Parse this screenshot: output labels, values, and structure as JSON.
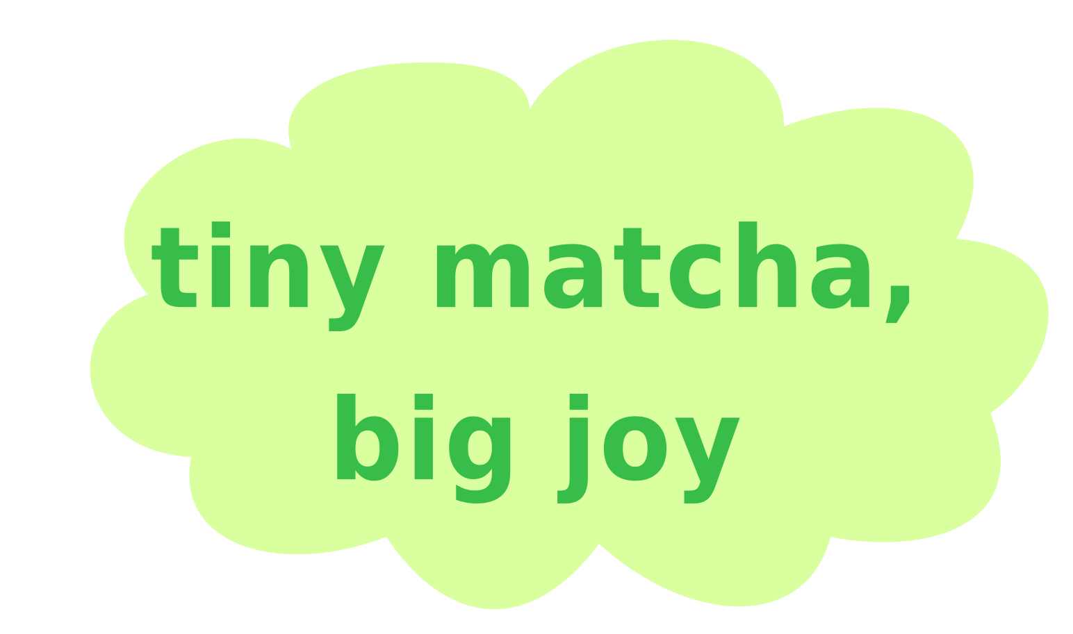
{
  "colors": {
    "cloud_fill": "#d9ff9e",
    "text": "#38bd4a",
    "background": "#ffffff"
  },
  "slogan": {
    "line1": "tiny matcha,",
    "line2": "big joy"
  }
}
